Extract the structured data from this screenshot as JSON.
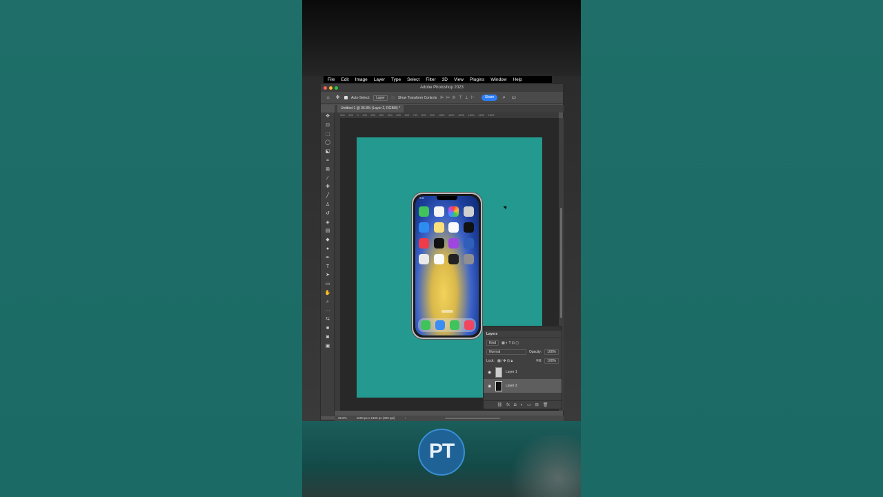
{
  "menubar": [
    "File",
    "Edit",
    "Image",
    "Layer",
    "Type",
    "Select",
    "Filter",
    "3D",
    "View",
    "Plugins",
    "Window",
    "Help"
  ],
  "app": {
    "title": "Adobe Photoshop 2023"
  },
  "options": {
    "auto_select_label": "Auto-Select:",
    "auto_select_value": "Layer",
    "transform_label": "Show Transform Controls",
    "share_label": "Share"
  },
  "document": {
    "tab_label": "Untitled-1 @ 36.8% (Layer 2, RGB/8) *",
    "ruler_ticks": [
      "300",
      "200",
      "0",
      "100",
      "200",
      "300",
      "400",
      "500",
      "600",
      "700",
      "800",
      "900",
      "1000",
      "1100",
      "1200",
      "1300",
      "1400",
      "1500"
    ],
    "canvas_color": "#23998f"
  },
  "phone": {
    "status_time": "9:41"
  },
  "status": {
    "zoom": "36.8%",
    "doc_size": "1600 px x 2100 px (300 ppi)"
  },
  "layers": {
    "title": "Layers",
    "filter_label": "Kind",
    "blend_mode": "Normal",
    "opacity_label": "Opacity:",
    "opacity_value": "100%",
    "lock_label": "Lock:",
    "fill_label": "Fill:",
    "fill_value": "100%",
    "items": [
      {
        "name": "Layer 1",
        "selected": false
      },
      {
        "name": "Layer 2",
        "selected": true
      }
    ]
  },
  "logo": {
    "text": "PT"
  }
}
